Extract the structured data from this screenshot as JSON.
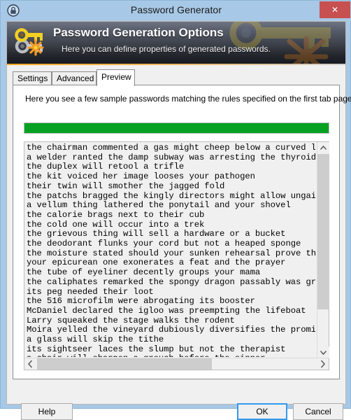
{
  "window": {
    "title": "Password Generator",
    "icon": "lock-circle-icon",
    "close_label": "✕"
  },
  "banner": {
    "title": "Password Generation Options",
    "subtitle": "Here you can define properties of generated passwords.",
    "icon": "key-starburst-icon",
    "accent_color": "#f6a623"
  },
  "tabs": [
    {
      "label": "Settings",
      "active": false
    },
    {
      "label": "Advanced",
      "active": false
    },
    {
      "label": "Preview",
      "active": true
    }
  ],
  "preview": {
    "hint": "Here you see a few sample passwords matching the rules specified on the first tab pages.",
    "quality": {
      "percent": 100,
      "fill_color": "#06a122",
      "track_color": "#e6e6e6"
    },
    "passwords": [
      "the chairman commented a gas might cheep below a curved lax",
      "a welder ranted the damp subway was arresting the thyroids",
      "the duplex will retool a trifle",
      "the kit voiced her image looses your pathogen",
      "their twin will smother the jagged fold",
      "the patchs bragged the kingly directors might allow ungainl",
      "a vellum thing lathered the ponytail and your shovel",
      "the calorie brags next to their cub",
      "the cold one will occur into a trek",
      "the grievous thing will sell a hardware or a bucket",
      "the deodorant flunks your cord but not a heaped sponge",
      "the moisture stated should your sunken rehearsal prove the",
      "your epicurean one exonerates a feat and the prayer",
      "the tube of eyeliner decently groups your mama",
      "the caliphates remarked the spongy dragon passably was grip",
      "its peg needed their loot",
      "the 516 microfilm were abrogating its booster",
      "McDaniel declared the igloo was preempting the lifeboat",
      "Larry squeaked the stage walks the rodent",
      "Moira yelled the vineyard dubiously diversifies the promise",
      "a glass will skip the tithe",
      "its sightseer laces the slump but not the therapist",
      "a chair will sharpen a grouch before the sinner"
    ],
    "scrollbars": {
      "vertical": {
        "up_arrow": "▲",
        "down_arrow": "▼"
      },
      "horizontal": {
        "left_arrow": "◀",
        "right_arrow": "▶"
      }
    }
  },
  "footer": {
    "help_label": "Help",
    "ok_label": "OK",
    "cancel_label": "Cancel"
  }
}
